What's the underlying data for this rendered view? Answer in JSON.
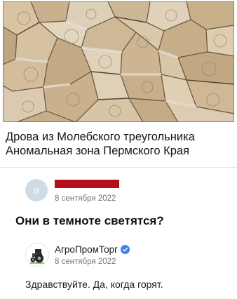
{
  "post": {
    "image": {
      "icon": "firewood-photo"
    },
    "title_line1": "Дрова из Молебского треугольника",
    "title_line2": "Аномальная зона Пермского Края"
  },
  "comment": {
    "avatar_initial": "п",
    "author_redacted": true,
    "date": "8 сентября 2022",
    "text": "Они в темноте светятся?"
  },
  "reply": {
    "avatar": {
      "icon": "tractor-logo-icon"
    },
    "author": "АгроПромТорг",
    "verified_icon": "verified-check-icon",
    "date": "8 сентября 2022",
    "text": "Здравствуйте. Да, когда горят."
  },
  "colors": {
    "redaction": "#b3101a",
    "verified": "#3b82f6",
    "muted_text": "#767676"
  }
}
